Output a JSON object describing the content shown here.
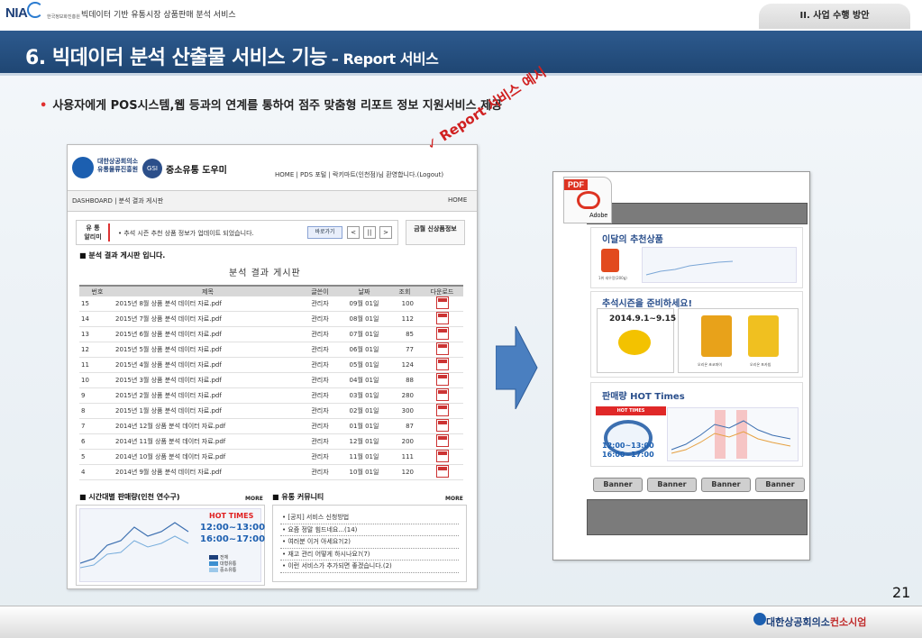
{
  "header": {
    "logo": "NIA",
    "logo_sub": "한국정보화진흥원",
    "doc_title": "빅데이터 기반 유통시장 상품판매 분석 서비스",
    "section_tab": "II. 사업 수행 방안"
  },
  "title": {
    "main": "6. 빅데이터 분석 산출물 서비스 기능",
    "sub": " – Report 서비스"
  },
  "bullet": "사용자에게 POS시스템,웹 등과의 연계를 통하여  점주 맞춤형 리포트 정보 지원서비스  제공",
  "callout": "✓  Report 서비스 예시",
  "webpage": {
    "org_name_line1": "대한상공회의소",
    "org_name_line2": "유통물류진흥원",
    "gsi": "GSI",
    "brand": "중소유통 도우미",
    "nav": "HOME | PDS 포털  | 락키마트(인천점)님 환영합니다.(Logout)",
    "breadcrumb": "DASHBOARD     |     분석 결과 게시판",
    "home": "HOME",
    "notice_label": "유  통\n알리미",
    "notice_text": "•  추석 시즌 추천 상품 정보가 업데이트 되었습니다.",
    "shortcut": "바로가기",
    "prev": "<",
    "pause": "||",
    "next": ">",
    "newbox": "금월 신상품정보",
    "board_heading": "■ 분석 결과 게시판 입니다.",
    "board_title": "분석 결과 게시판",
    "columns": [
      "번호",
      "제목",
      "글쓴이",
      "날짜",
      "조회",
      "다운로드"
    ],
    "rows": [
      {
        "no": "15",
        "title": "2015년 8월 상품 분석 데이터 자료.pdf",
        "author": "관리자",
        "date": "09월 01일",
        "views": "100"
      },
      {
        "no": "14",
        "title": "2015년 7월 상품 분석 데이터 자료.pdf",
        "author": "관리자",
        "date": "08월 01일",
        "views": "112"
      },
      {
        "no": "13",
        "title": "2015년 6월 상품 분석 데이터 자료.pdf",
        "author": "관리자",
        "date": "07월 01일",
        "views": "85"
      },
      {
        "no": "12",
        "title": "2015년 5월 상품 분석 데이터 자료.pdf",
        "author": "관리자",
        "date": "06월 01일",
        "views": "77"
      },
      {
        "no": "11",
        "title": "2015년 4월 상품 분석 데이터 자료.pdf",
        "author": "관리자",
        "date": "05월 01일",
        "views": "124"
      },
      {
        "no": "10",
        "title": "2015년 3월 상품 분석 데이터 자료.pdf",
        "author": "관리자",
        "date": "04월 01일",
        "views": "88"
      },
      {
        "no": "9",
        "title": "2015년 2월 상품 분석 데이터 자료.pdf",
        "author": "관리자",
        "date": "03월 01일",
        "views": "280"
      },
      {
        "no": "8",
        "title": "2015년 1월 상품 분석 데이터 자료.pdf",
        "author": "관리자",
        "date": "02월 01일",
        "views": "300"
      },
      {
        "no": "7",
        "title": "2014년 12월 상품 분석 데이터 자료.pdf",
        "author": "관리자",
        "date": "01월 01일",
        "views": "87"
      },
      {
        "no": "6",
        "title": "2014년 11월 상품 분석 데이터 자료.pdf",
        "author": "관리자",
        "date": "12월 01일",
        "views": "200"
      },
      {
        "no": "5",
        "title": "2014년 10월 상품 분석 데이터 자료.pdf",
        "author": "관리자",
        "date": "11월 01일",
        "views": "111"
      },
      {
        "no": "4",
        "title": "2014년 9월 상품 분석 데이터 자료.pdf",
        "author": "관리자",
        "date": "10월 01일",
        "views": "120"
      }
    ],
    "sales_heading": "■ 시간대별 판매량(인천 연수구)",
    "more": "MORE",
    "hot_times": "HOT TIMES",
    "time1": "12:00~13:00",
    "time2": "16:00~17:00",
    "legend": [
      "전체",
      "대형유통",
      "중소유통"
    ],
    "community_heading": "■ 유통 커뮤니티",
    "community": [
      "[공지] 서비스 신청방법",
      "요즘 정말 힘드네요...(14)",
      "여러분 이거 아세요?(2)",
      "재고 관리 어떻게 하시나요?(7)",
      "이런 서비스가 추가되면 좋겠습니다.(2)"
    ]
  },
  "report": {
    "pdf_label": "PDF",
    "adobe": "Adobe",
    "rec_title": "이달의 추천상품",
    "rec_caption": "1위 새우깡(200g)",
    "season_title": "추석시즌을 준비하세요!",
    "season_date": "2014.9.1~9.15",
    "snack1": "오리온 초코파이",
    "snack2": "오리온 포카칩",
    "hot_title": "판매량 HOT Times",
    "hot_badge": "HOT TIMES",
    "time1": "12:00~13:00",
    "time2": "16:00~17:00",
    "banners": [
      "Banner",
      "Banner",
      "Banner",
      "Banner"
    ]
  },
  "page_number": "21",
  "footer_logo_main": "대한상공회의소",
  "footer_logo_accent": "컨소시엄",
  "colors": {
    "title_bar": "#2d5a8e",
    "accent_red": "#d02020",
    "accent_blue": "#1c5fb0",
    "arrow": "#4a7fc0"
  }
}
